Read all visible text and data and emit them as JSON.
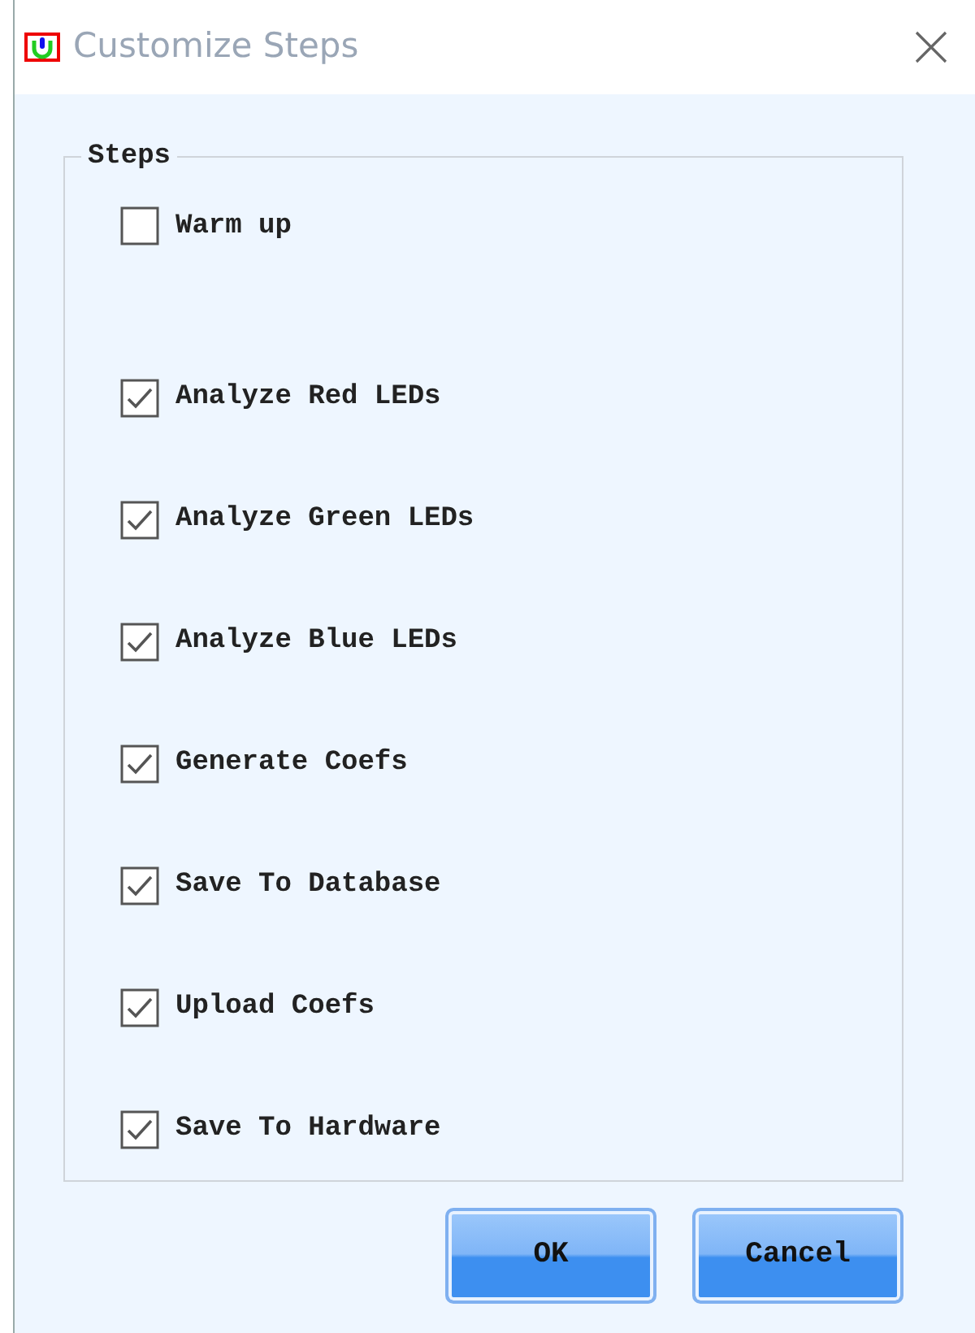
{
  "window": {
    "title": "Customize Steps"
  },
  "group": {
    "label": "Steps"
  },
  "steps": [
    {
      "label": "Warm up",
      "checked": false
    },
    {
      "label": "Analyze Red LEDs",
      "checked": true
    },
    {
      "label": "Analyze Green LEDs",
      "checked": true
    },
    {
      "label": "Analyze Blue LEDs",
      "checked": true
    },
    {
      "label": "Generate Coefs",
      "checked": true
    },
    {
      "label": "Save To Database",
      "checked": true
    },
    {
      "label": "Upload Coefs",
      "checked": true
    },
    {
      "label": "Save To Hardware",
      "checked": true
    }
  ],
  "buttons": [
    "OK",
    "Cancel"
  ]
}
